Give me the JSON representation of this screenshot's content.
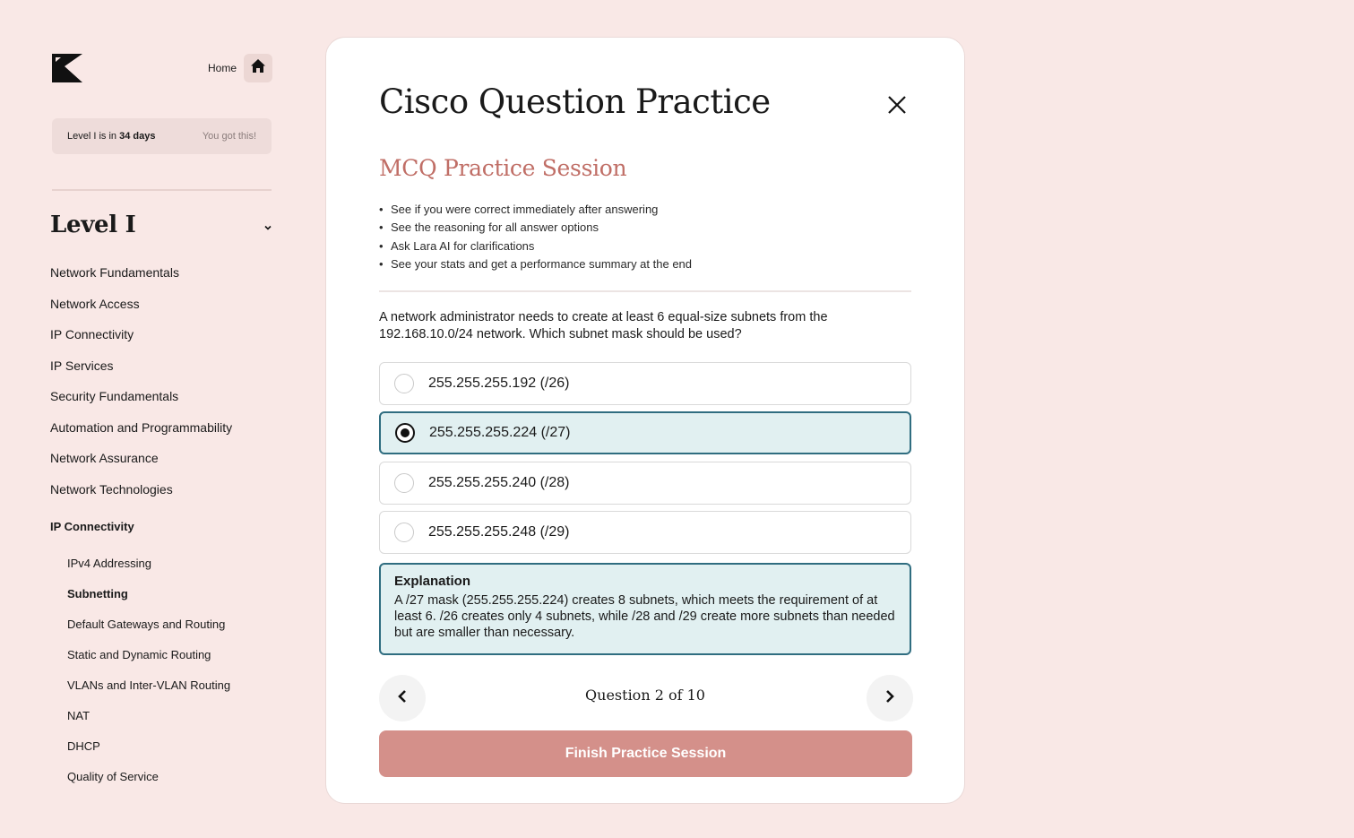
{
  "colors": {
    "background": "#f9e8e6",
    "accent_title": "#c06e66",
    "selected_fill": "#e1f0f1",
    "selected_border": "#2f6d80",
    "finish_button": "#d4908a"
  },
  "sidebar": {
    "logo_icon": "k-logo-icon",
    "home_label": "Home",
    "home_icon": "home-icon",
    "countdown": {
      "prefix": "Level I is in",
      "days": "34 days",
      "encouragement": "You got this!"
    },
    "level_title": "Level I",
    "level_chevron_icon": "chevron-down-icon",
    "topics": [
      "Network Fundamentals",
      "Network Access",
      "IP Connectivity",
      "IP Services",
      "Security Fundamentals",
      "Automation and Programmability",
      "Network Assurance",
      "Network Technologies"
    ],
    "current_section": "IP Connectivity",
    "subtopics": [
      "IPv4 Addressing",
      "Subnetting",
      "Default Gateways and Routing",
      "Static and Dynamic Routing",
      "VLANs and Inter-VLAN Routing",
      "NAT",
      "DHCP",
      "Quality of Service"
    ],
    "active_subtopic": "Subnetting"
  },
  "modal": {
    "title": "Cisco Question Practice",
    "close_icon": "close-icon",
    "session_title": "MCQ Practice Session",
    "bullets": [
      "See if you were correct immediately after answering",
      "See the reasoning for all answer options",
      "Ask Lara AI for clarifications",
      "See your stats and get a performance summary at the end"
    ],
    "question": "A network administrator needs to create at least 6 equal-size subnets from the 192.168.10.0/24 network. Which subnet mask should be used?",
    "options": [
      {
        "label": "255.255.255.192 (/26)",
        "selected": false
      },
      {
        "label": "255.255.255.224 (/27)",
        "selected": true
      },
      {
        "label": "255.255.255.240 (/28)",
        "selected": false
      },
      {
        "label": "255.255.255.248 (/29)",
        "selected": false
      }
    ],
    "explanation": {
      "heading": "Explanation",
      "body": "A /27 mask (255.255.255.224) creates 8 subnets, which meets the requirement of at least 6. /26 creates only 4 subnets, while /28 and /29 create more subnets than needed but are smaller than necessary."
    },
    "nav": {
      "prev_icon": "chevron-left-icon",
      "next_icon": "chevron-right-icon",
      "counter": "Question 2 of 10"
    },
    "finish_label": "Finish Practice Session"
  }
}
